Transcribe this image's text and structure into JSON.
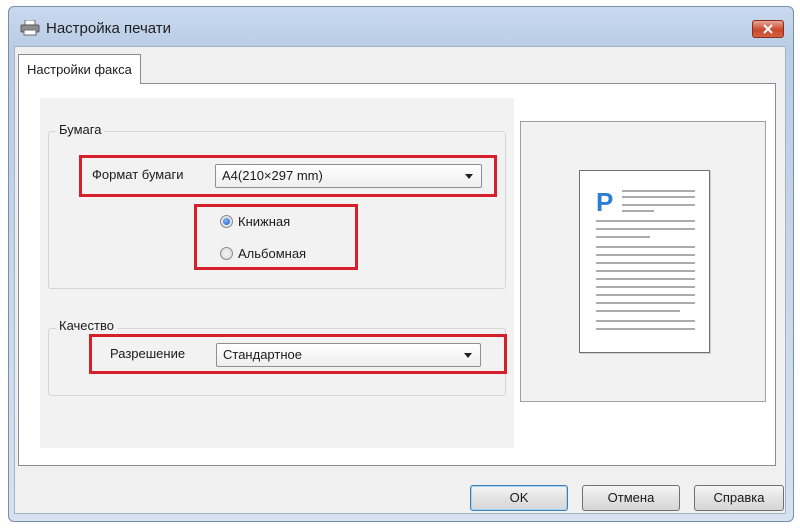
{
  "window": {
    "title": "Настройка печати",
    "icon": "printer-icon",
    "close_icon": "close-icon"
  },
  "tabs": [
    {
      "label": "Настройки факса",
      "active": true
    }
  ],
  "paper_group": {
    "label": "Бумага",
    "paper_size_label": "Формат бумаги",
    "paper_size_value": "A4(210×297 mm)",
    "orientation_options": [
      {
        "label": "Книжная",
        "checked": true
      },
      {
        "label": "Альбомная",
        "checked": false
      }
    ]
  },
  "quality_group": {
    "label": "Качество",
    "resolution_label": "Разрешение",
    "resolution_value": "Стандартное"
  },
  "preview": {
    "page_letter": "P"
  },
  "buttons": {
    "ok": "OK",
    "cancel": "Отмена",
    "help": "Справка"
  },
  "colors": {
    "highlight": "#d51f2b",
    "preview_accent": "#2a7fd4"
  }
}
